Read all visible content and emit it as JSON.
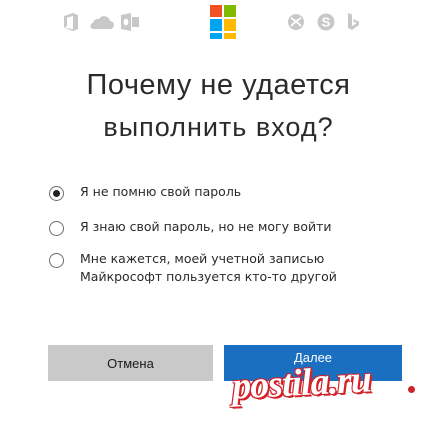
{
  "header": {
    "service_icons": [
      "office-icon",
      "onedrive-icon",
      "outlook-icon",
      "microsoft-logo",
      "xbox-icon",
      "skype-icon",
      "bing-icon"
    ],
    "logo_colors": [
      "#f25022",
      "#7fba00",
      "#00a4ef",
      "#ffb900"
    ],
    "icon_color": "#c8c8c8"
  },
  "main": {
    "title_line1": "Почему не удается",
    "title_line2": "выполнить вход?"
  },
  "options": [
    {
      "label": "Я не помню свой пароль",
      "checked": true
    },
    {
      "label": "Я знаю свой пароль, но не могу войти",
      "checked": false
    },
    {
      "label_line1": "Мне кажется, моей учетной записью",
      "label_line2": "Майкрософт пользуется кто-то другой",
      "checked": false
    }
  ],
  "buttons": {
    "cancel_label": "Отмена",
    "next_label": "Далее"
  },
  "watermark": {
    "text": "postila.ru"
  }
}
